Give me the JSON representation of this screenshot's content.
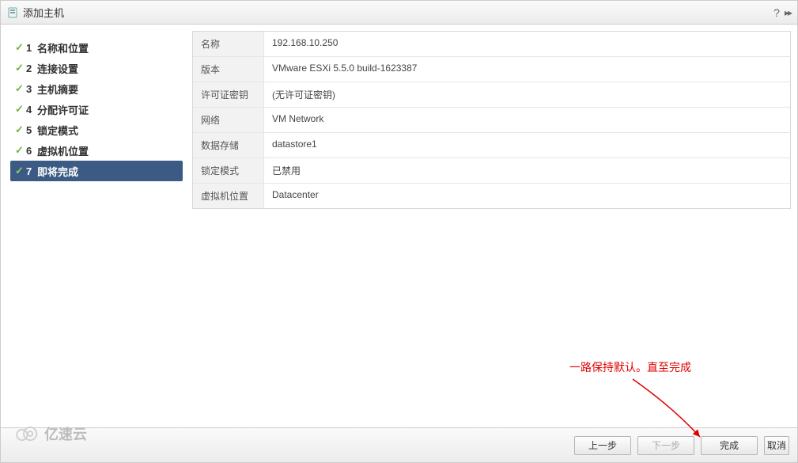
{
  "titlebar": {
    "title": "添加主机"
  },
  "sidebar": {
    "steps": [
      {
        "num": "1",
        "label": "名称和位置",
        "done": true
      },
      {
        "num": "2",
        "label": "连接设置",
        "done": true
      },
      {
        "num": "3",
        "label": "主机摘要",
        "done": true
      },
      {
        "num": "4",
        "label": "分配许可证",
        "done": true
      },
      {
        "num": "5",
        "label": "锁定模式",
        "done": true
      },
      {
        "num": "6",
        "label": "虚拟机位置",
        "done": true
      },
      {
        "num": "7",
        "label": "即将完成",
        "done": true,
        "active": true
      }
    ]
  },
  "summary": {
    "rows": [
      {
        "key": "名称",
        "value": "192.168.10.250"
      },
      {
        "key": "版本",
        "value": "VMware ESXi 5.5.0 build-1623387"
      },
      {
        "key": "许可证密钥",
        "value": "(无许可证密钥)"
      },
      {
        "key": "网络",
        "value": "VM Network"
      },
      {
        "key": "数据存储",
        "value": "datastore1"
      },
      {
        "key": "锁定模式",
        "value": "已禁用"
      },
      {
        "key": "虚拟机位置",
        "value": "Datacenter"
      }
    ]
  },
  "footer": {
    "back": "上一步",
    "next": "下一步",
    "finish": "完成",
    "cancel": "取消"
  },
  "annotation": {
    "text": "一路保持默认。直至完成"
  },
  "watermark": {
    "text": "亿速云"
  }
}
